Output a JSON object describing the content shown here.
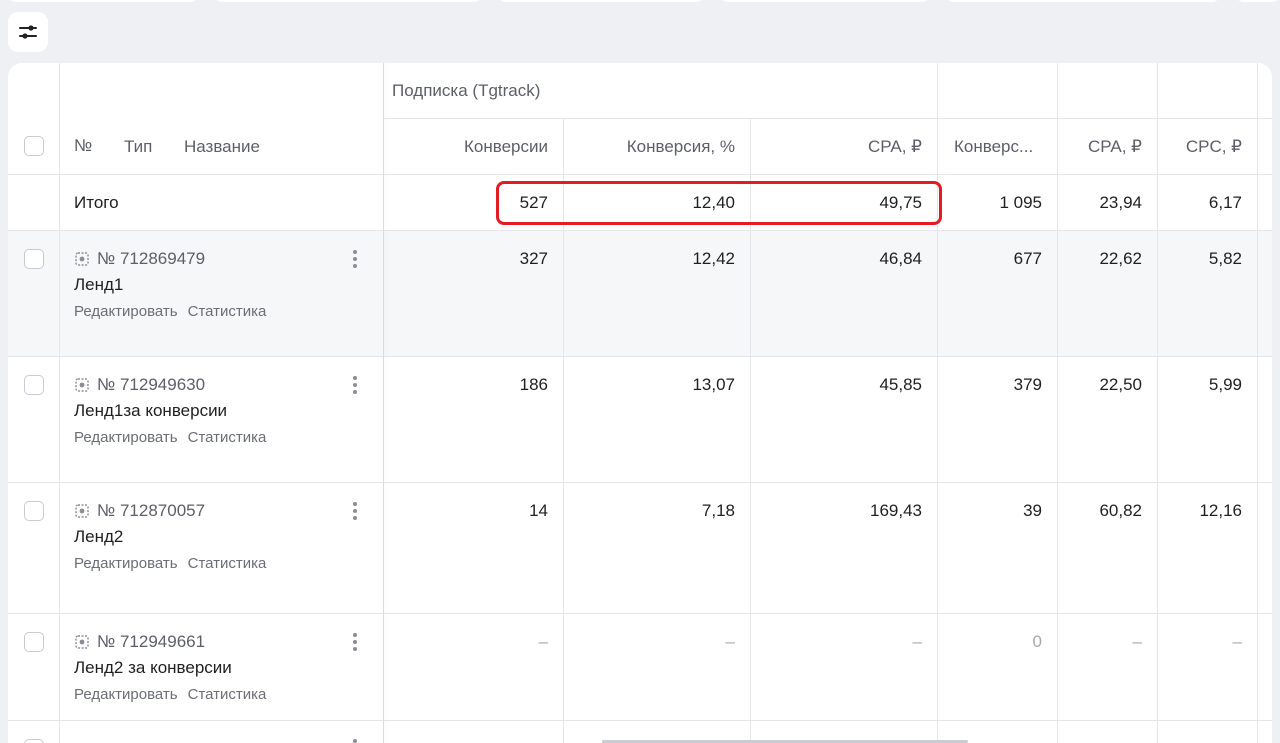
{
  "header": {
    "group_label": "Подписка (Tgtrack)",
    "columns": {
      "number": "№",
      "type": "Тип",
      "name": "Название",
      "conversions": "Конверсии",
      "conversion_pct": "Конверсия, %",
      "cpa": "CPA, ₽",
      "conversions_trunc": "Конверс...",
      "cpa2": "CPA, ₽",
      "cpc": "CPC, ₽"
    }
  },
  "total": {
    "label": "Итого",
    "conversions": "527",
    "conversion_pct": "12,40",
    "cpa": "49,75",
    "conversions2": "1 095",
    "cpa2": "23,94",
    "cpc": "6,17"
  },
  "rows": [
    {
      "id": "№ 712869479",
      "title": "Ленд1",
      "edit": "Редактировать",
      "stats": "Статистика",
      "conversions": "327",
      "conversion_pct": "12,42",
      "cpa": "46,84",
      "conversions2": "677",
      "cpa2": "22,62",
      "cpc": "5,82"
    },
    {
      "id": "№ 712949630",
      "title": "Ленд1за конверсии",
      "edit": "Редактировать",
      "stats": "Статистика",
      "conversions": "186",
      "conversion_pct": "13,07",
      "cpa": "45,85",
      "conversions2": "379",
      "cpa2": "22,50",
      "cpc": "5,99"
    },
    {
      "id": "№ 712870057",
      "title": "Ленд2",
      "edit": "Редактировать",
      "stats": "Статистика",
      "conversions": "14",
      "conversion_pct": "7,18",
      "cpa": "169,43",
      "conversions2": "39",
      "cpa2": "60,82",
      "cpc": "12,16"
    },
    {
      "id": "№ 712949661",
      "title": "Ленд2 за конверсии",
      "edit": "Редактировать",
      "stats": "Статистика",
      "conversions": "–",
      "conversion_pct": "–",
      "cpa": "–",
      "conversions2": "0",
      "cpa2": "–",
      "cpc": "–"
    }
  ]
}
